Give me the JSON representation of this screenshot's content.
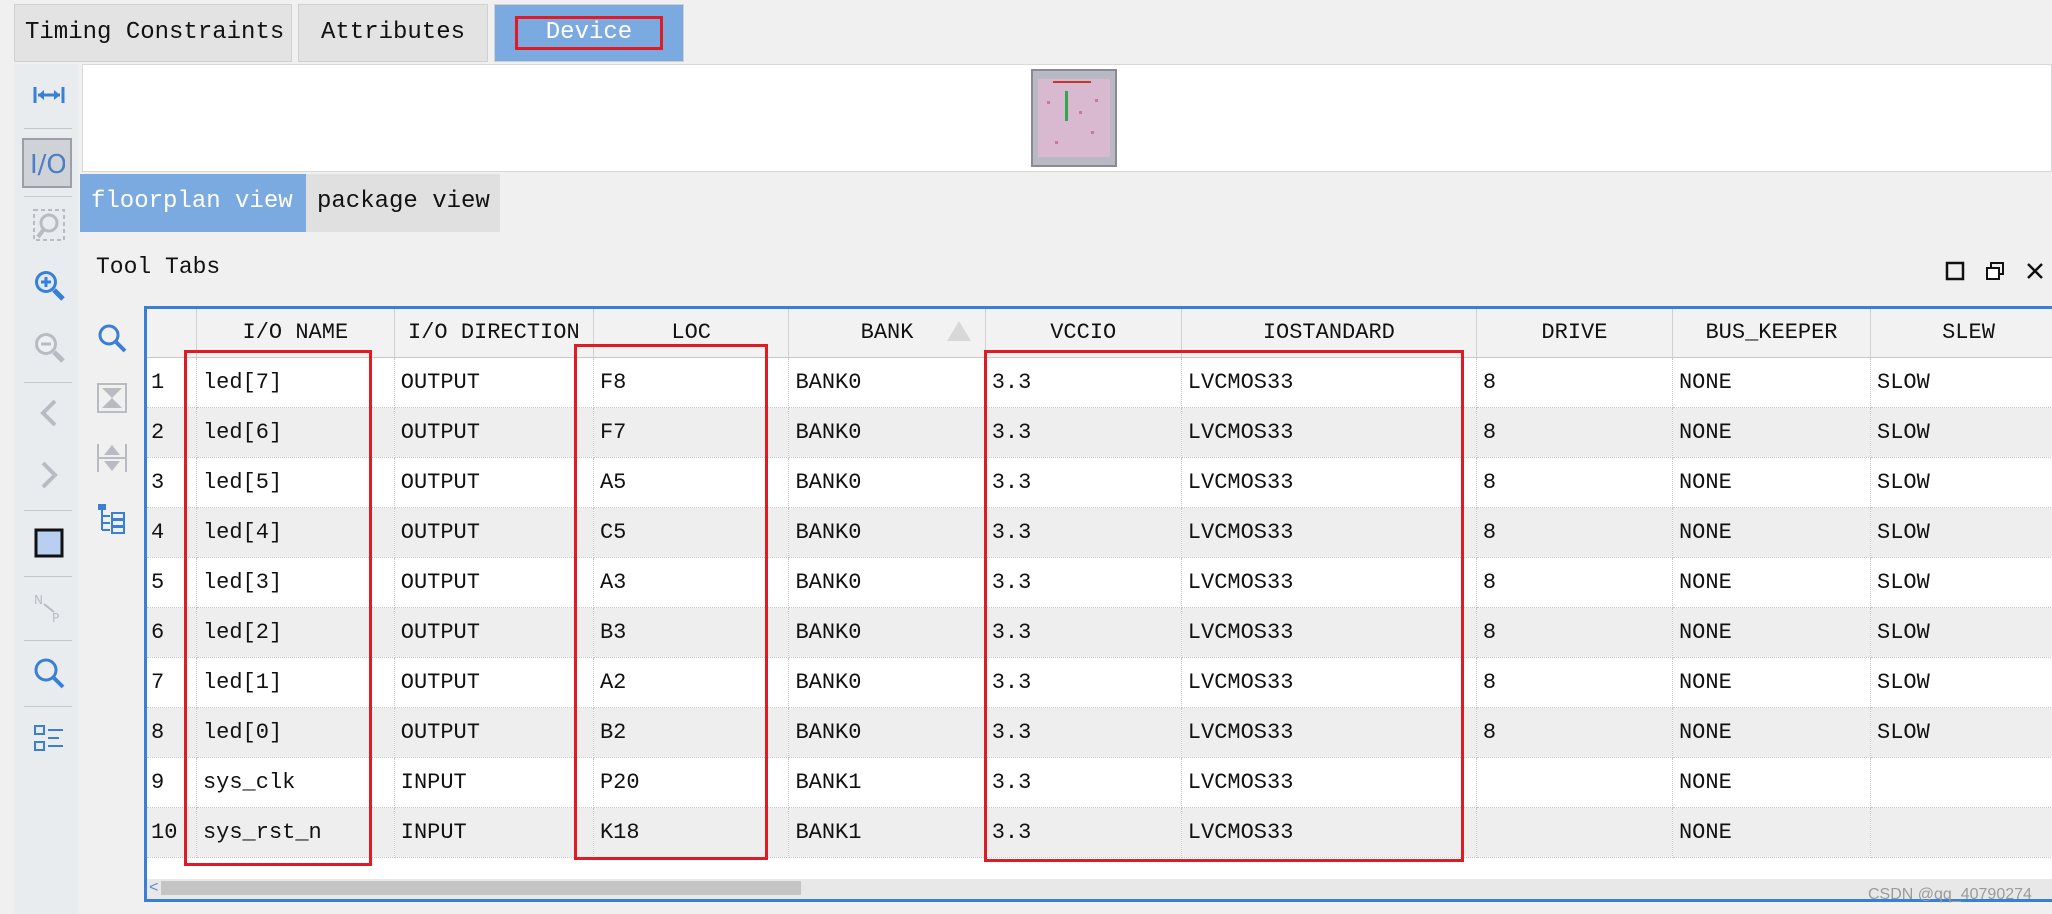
{
  "top_tabs": [
    {
      "label": "Timing Constraints"
    },
    {
      "label": "Attributes"
    },
    {
      "label": "Device",
      "active": true
    }
  ],
  "view_tabs": [
    {
      "label": "floorplan view",
      "active": true
    },
    {
      "label": "package view"
    }
  ],
  "panel": {
    "title": "Tool Tabs"
  },
  "left_toolbar_icons": [
    "fit-width-icon",
    "io-icon",
    "zoom-area-icon",
    "zoom-in-icon",
    "zoom-out-icon",
    "back-icon",
    "forward-icon",
    "select-box-icon",
    "net-path-icon",
    "search-icon",
    "properties-icon"
  ],
  "table": {
    "columns": [
      "I/O NAME",
      "I/O DIRECTION",
      "LOC",
      "BANK",
      "VCCIO",
      "IOSTANDARD",
      "DRIVE",
      "BUS_KEEPER",
      "SLEW"
    ],
    "rows": [
      {
        "n": "1",
        "cells": [
          "led[7]",
          "OUTPUT",
          "F8",
          "BANK0",
          "3.3",
          "LVCMOS33",
          "8",
          "NONE",
          "SLOW"
        ]
      },
      {
        "n": "2",
        "cells": [
          "led[6]",
          "OUTPUT",
          "F7",
          "BANK0",
          "3.3",
          "LVCMOS33",
          "8",
          "NONE",
          "SLOW"
        ]
      },
      {
        "n": "3",
        "cells": [
          "led[5]",
          "OUTPUT",
          "A5",
          "BANK0",
          "3.3",
          "LVCMOS33",
          "8",
          "NONE",
          "SLOW"
        ]
      },
      {
        "n": "4",
        "cells": [
          "led[4]",
          "OUTPUT",
          "C5",
          "BANK0",
          "3.3",
          "LVCMOS33",
          "8",
          "NONE",
          "SLOW"
        ]
      },
      {
        "n": "5",
        "cells": [
          "led[3]",
          "OUTPUT",
          "A3",
          "BANK0",
          "3.3",
          "LVCMOS33",
          "8",
          "NONE",
          "SLOW"
        ]
      },
      {
        "n": "6",
        "cells": [
          "led[2]",
          "OUTPUT",
          "B3",
          "BANK0",
          "3.3",
          "LVCMOS33",
          "8",
          "NONE",
          "SLOW"
        ]
      },
      {
        "n": "7",
        "cells": [
          "led[1]",
          "OUTPUT",
          "A2",
          "BANK0",
          "3.3",
          "LVCMOS33",
          "8",
          "NONE",
          "SLOW"
        ]
      },
      {
        "n": "8",
        "cells": [
          "led[0]",
          "OUTPUT",
          "B2",
          "BANK0",
          "3.3",
          "LVCMOS33",
          "8",
          "NONE",
          "SLOW"
        ]
      },
      {
        "n": "9",
        "cells": [
          "sys_clk",
          "INPUT",
          "P20",
          "BANK1",
          "3.3",
          "LVCMOS33",
          "",
          "NONE",
          ""
        ]
      },
      {
        "n": "10",
        "cells": [
          "sys_rst_n",
          "INPUT",
          "K18",
          "BANK1",
          "3.3",
          "LVCMOS33",
          "",
          "NONE",
          ""
        ]
      }
    ]
  },
  "colors": {
    "accent": "#7aaae0",
    "highlight": "#e01b24",
    "panel_border": "#3a7fd6"
  },
  "watermark": "CSDN @qq_40790274"
}
